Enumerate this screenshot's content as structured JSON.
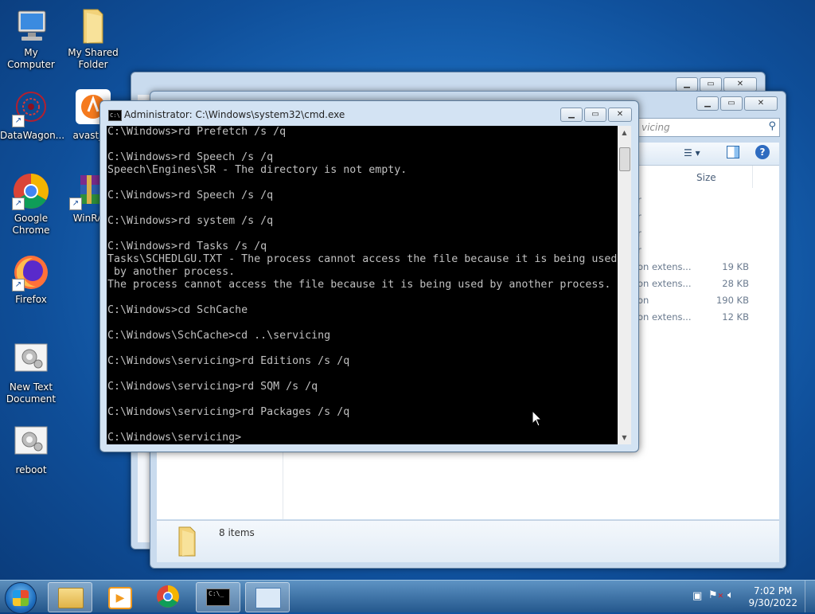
{
  "desktop": {
    "icons": [
      {
        "label": "My Computer",
        "icon": "computer-icon"
      },
      {
        "label": "My Shared Folder",
        "icon": "folder-icon"
      },
      {
        "label": "DataWagon...",
        "icon": "datawagon-icon"
      },
      {
        "label": "avast_or",
        "icon": "avast-icon"
      },
      {
        "label": "Google Chrome",
        "icon": "chrome-icon"
      },
      {
        "label": "WinRA",
        "icon": "winrar-icon"
      },
      {
        "label": "Firefox",
        "icon": "firefox-icon"
      },
      {
        "label": "New Text Document",
        "icon": "batch-file-icon"
      },
      {
        "label": "reboot",
        "icon": "batch-file-icon"
      }
    ]
  },
  "explorer": {
    "search_placeholder": "vicing",
    "column_size": "Size",
    "rows": [
      {
        "type": "r",
        "size": ""
      },
      {
        "type": "r",
        "size": ""
      },
      {
        "type": "r",
        "size": ""
      },
      {
        "type": "r",
        "size": ""
      },
      {
        "type": "on extens...",
        "size": "19 KB"
      },
      {
        "type": "on extens...",
        "size": "28 KB"
      },
      {
        "type": "on",
        "size": "190 KB"
      },
      {
        "type": "on extens...",
        "size": "12 KB"
      }
    ],
    "status": "8 items"
  },
  "cmd": {
    "title": "Administrator: C:\\Windows\\system32\\cmd.exe",
    "lines": [
      "C:\\Windows>rd Prefetch /s /q",
      "",
      "C:\\Windows>rd Speech /s /q",
      "Speech\\Engines\\SR - The directory is not empty.",
      "",
      "C:\\Windows>rd Speech /s /q",
      "",
      "C:\\Windows>rd system /s /q",
      "",
      "C:\\Windows>rd Tasks /s /q",
      "Tasks\\SCHEDLGU.TXT - The process cannot access the file because it is being used",
      " by another process.",
      "The process cannot access the file because it is being used by another process.",
      "",
      "C:\\Windows>cd SchCache",
      "",
      "C:\\Windows\\SchCache>cd ..\\servicing",
      "",
      "C:\\Windows\\servicing>rd Editions /s /q",
      "",
      "C:\\Windows\\servicing>rd SQM /s /q",
      "",
      "C:\\Windows\\servicing>rd Packages /s /q",
      "",
      "C:\\Windows\\servicing>"
    ]
  },
  "taskbar": {
    "items": [
      "explorer-icon",
      "media-player-icon",
      "chrome-icon",
      "cmd-icon",
      "control-panel-icon"
    ],
    "time": "7:02 PM",
    "date": "9/30/2022"
  },
  "colors": {
    "console_bg": "#000000",
    "console_fg": "#c0c0c0",
    "desktop": "#1b6bbd"
  }
}
